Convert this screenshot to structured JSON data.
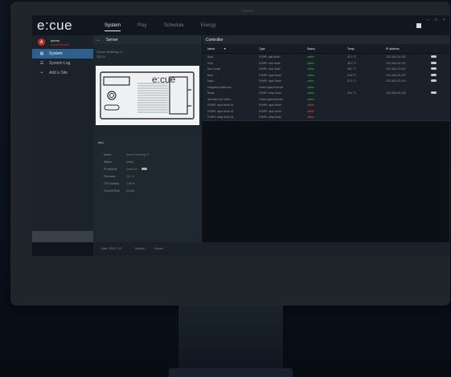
{
  "app": {
    "logo": "e:cue"
  },
  "nav": {
    "tabs": [
      "System",
      "Play",
      "Schedule",
      "Energy"
    ]
  },
  "window": {
    "minimize": "–",
    "maximize": "□",
    "close": "×"
  },
  "user": {
    "initial": "A",
    "name": "admin",
    "role": "Administrator"
  },
  "sidebar": {
    "items": [
      {
        "label": "System",
        "icon": "server-icon"
      },
      {
        "label": "System Log",
        "icon": "list-icon"
      },
      {
        "label": "Add a Site",
        "icon": "plus-icon"
      }
    ]
  },
  "server": {
    "back": "←",
    "title": "Server",
    "name": "Server Building 17",
    "subtitle": "SECU",
    "device_logo": "e:cue",
    "info": {
      "title": "Info",
      "rows": [
        {
          "key": "Name",
          "value": "Server Building 17"
        },
        {
          "key": "Status",
          "value": "online"
        },
        {
          "key": "IP address",
          "value": "localhost"
        },
        {
          "key": "Firmware",
          "value": "16.1.0"
        },
        {
          "key": "CPU activity",
          "value": "3.55 %"
        },
        {
          "key": "Current Role",
          "value": "Master"
        }
      ]
    }
  },
  "controller": {
    "title": "Controller",
    "columns": [
      "Name",
      "Type",
      "Status",
      "Temp",
      "IP address"
    ],
    "rows": [
      {
        "name": "Stop",
        "type": "SYMPL dali Node",
        "status": "online",
        "temp": "41.2 °C",
        "ip": "192.168.123.101"
      },
      {
        "name": "Door",
        "type": "SYMPL dmx Node",
        "status": "online",
        "temp": "38.2 °C",
        "ip": "192.168.123.107"
      },
      {
        "name": "Door mode",
        "type": "SYMPL dmx Node",
        "status": "online",
        "temp": "38.1 °C",
        "ip": "192.168.123.110"
      },
      {
        "name": "Blue",
        "type": "SYMPL input Node",
        "status": "online",
        "temp": "35.8 °C",
        "ip": "192.168.123.102"
      },
      {
        "name": "Input",
        "type": "SYMPL input Node",
        "status": "online",
        "temp": "37.4 °C",
        "ip": "192.168.123.104"
      },
      {
        "name": "Integration Webcam",
        "type": "VideoCaptureDevice",
        "status": "online",
        "temp": "",
        "ip": ""
      },
      {
        "name": "Relay",
        "type": "SYMPL relay Node",
        "status": "online",
        "temp": "36.1 °C",
        "ip": "192.168.123.105"
      },
      {
        "name": "SpeedorCam Video",
        "type": "VideoCaptureDevice",
        "status": "online",
        "temp": "",
        "ip": ""
      },
      {
        "name": "SYMPL input Node #1",
        "type": "SYMPL input Node",
        "status": "offline",
        "temp": "",
        "ip": ""
      },
      {
        "name": "SYMPL input Node #1",
        "type": "SYMPL input Node",
        "status": "offline",
        "temp": "",
        "ip": ""
      },
      {
        "name": "SYMPL relay Node #1",
        "type": "SYMPL relay Node",
        "status": "offline",
        "temp": "",
        "ip": ""
      }
    ]
  },
  "status_bar": {
    "date": "Date: 2024-7-10",
    "sunrise": "Sunrise",
    "sunset": "Sunset"
  },
  "colors": {
    "accent": "#2f5f8f",
    "online": "#3fb950",
    "offline": "#e5484d",
    "brand": "#c72c2c"
  }
}
